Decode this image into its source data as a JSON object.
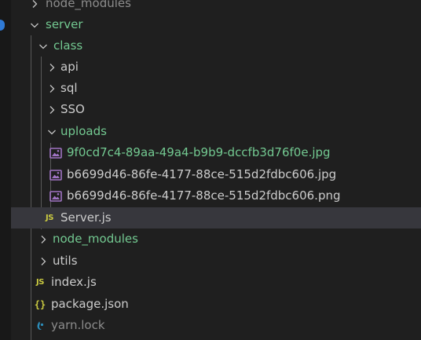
{
  "explorer": {
    "tree": [
      {
        "label": "node_modules",
        "kind": "folder",
        "state": "collapsed"
      },
      {
        "label": "server",
        "kind": "folder",
        "state": "expanded"
      },
      {
        "label": "class",
        "kind": "folder",
        "state": "expanded"
      },
      {
        "label": "api",
        "kind": "folder",
        "state": "collapsed"
      },
      {
        "label": "sql",
        "kind": "folder",
        "state": "collapsed"
      },
      {
        "label": "SSO",
        "kind": "folder",
        "state": "collapsed"
      },
      {
        "label": "uploads",
        "kind": "folder",
        "state": "expanded"
      },
      {
        "label": "9f0cd7c4-89aa-49a4-b9b9-dccfb3d76f0e.jpg",
        "kind": "file",
        "icon": "image-icon"
      },
      {
        "label": "b6699d46-86fe-4177-88ce-515d2fdbc606.jpg",
        "kind": "file",
        "icon": "image-icon"
      },
      {
        "label": "b6699d46-86fe-4177-88ce-515d2fdbc606.png",
        "kind": "file",
        "icon": "image-icon"
      },
      {
        "label": "Server.js",
        "kind": "file",
        "icon": "js-icon",
        "badge": "JS",
        "selected": true
      },
      {
        "label": "node_modules",
        "kind": "folder",
        "state": "collapsed"
      },
      {
        "label": "utils",
        "kind": "folder",
        "state": "collapsed"
      },
      {
        "label": "index.js",
        "kind": "file",
        "icon": "js-icon",
        "badge": "JS"
      },
      {
        "label": "package.json",
        "kind": "file",
        "icon": "json-icon",
        "badge": "{}"
      },
      {
        "label": "yarn.lock",
        "kind": "file",
        "icon": "yarn-icon"
      }
    ]
  },
  "colors": {
    "background": "#1f1f1f",
    "selected_row": "#37373d",
    "git_added": "#73c991",
    "text": "#cccccc",
    "muted": "#8c8c8c",
    "js_badge": "#cbcb41",
    "image_icon": "#a074c4",
    "yarn_icon": "#2c8ebb"
  }
}
